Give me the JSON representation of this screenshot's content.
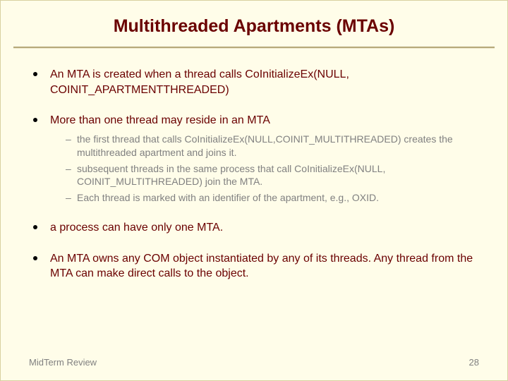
{
  "title": "Multithreaded Apartments (MTAs)",
  "bullets": {
    "b0": "An MTA is created when a thread calls CoInitializeEx(NULL, COINIT_APARTMENTTHREADED)",
    "b1": "More than one thread may reside in an MTA",
    "b1_sub": {
      "s0": "the first thread that calls CoInitializeEx(NULL,COINIT_MULTITHREADED) creates the multithreaded apartment and joins it.",
      "s1": "subsequent threads in the same process that call CoInitializeEx(NULL, COINIT_MULTITHREADED) join the MTA.",
      "s2": "Each thread is marked with an identifier of the apartment, e.g., OXID."
    },
    "b2": "a process can have only one MTA.",
    "b3": "An MTA owns any COM object instantiated by any of its threads.  Any thread from the MTA can make direct calls to the object."
  },
  "footer": {
    "left": "MidTerm Review",
    "right": "28"
  }
}
